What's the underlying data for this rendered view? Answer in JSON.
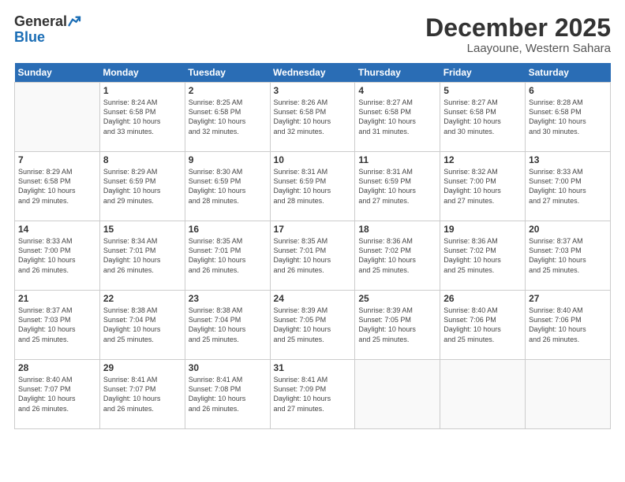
{
  "logo": {
    "line1": "General",
    "line2": "Blue"
  },
  "title": "December 2025",
  "subtitle": "Laayoune, Western Sahara",
  "weekdays": [
    "Sunday",
    "Monday",
    "Tuesday",
    "Wednesday",
    "Thursday",
    "Friday",
    "Saturday"
  ],
  "weeks": [
    [
      {
        "day": "",
        "info": ""
      },
      {
        "day": "1",
        "info": "Sunrise: 8:24 AM\nSunset: 6:58 PM\nDaylight: 10 hours\nand 33 minutes."
      },
      {
        "day": "2",
        "info": "Sunrise: 8:25 AM\nSunset: 6:58 PM\nDaylight: 10 hours\nand 32 minutes."
      },
      {
        "day": "3",
        "info": "Sunrise: 8:26 AM\nSunset: 6:58 PM\nDaylight: 10 hours\nand 32 minutes."
      },
      {
        "day": "4",
        "info": "Sunrise: 8:27 AM\nSunset: 6:58 PM\nDaylight: 10 hours\nand 31 minutes."
      },
      {
        "day": "5",
        "info": "Sunrise: 8:27 AM\nSunset: 6:58 PM\nDaylight: 10 hours\nand 30 minutes."
      },
      {
        "day": "6",
        "info": "Sunrise: 8:28 AM\nSunset: 6:58 PM\nDaylight: 10 hours\nand 30 minutes."
      }
    ],
    [
      {
        "day": "7",
        "info": "Sunrise: 8:29 AM\nSunset: 6:58 PM\nDaylight: 10 hours\nand 29 minutes."
      },
      {
        "day": "8",
        "info": "Sunrise: 8:29 AM\nSunset: 6:59 PM\nDaylight: 10 hours\nand 29 minutes."
      },
      {
        "day": "9",
        "info": "Sunrise: 8:30 AM\nSunset: 6:59 PM\nDaylight: 10 hours\nand 28 minutes."
      },
      {
        "day": "10",
        "info": "Sunrise: 8:31 AM\nSunset: 6:59 PM\nDaylight: 10 hours\nand 28 minutes."
      },
      {
        "day": "11",
        "info": "Sunrise: 8:31 AM\nSunset: 6:59 PM\nDaylight: 10 hours\nand 27 minutes."
      },
      {
        "day": "12",
        "info": "Sunrise: 8:32 AM\nSunset: 7:00 PM\nDaylight: 10 hours\nand 27 minutes."
      },
      {
        "day": "13",
        "info": "Sunrise: 8:33 AM\nSunset: 7:00 PM\nDaylight: 10 hours\nand 27 minutes."
      }
    ],
    [
      {
        "day": "14",
        "info": "Sunrise: 8:33 AM\nSunset: 7:00 PM\nDaylight: 10 hours\nand 26 minutes."
      },
      {
        "day": "15",
        "info": "Sunrise: 8:34 AM\nSunset: 7:01 PM\nDaylight: 10 hours\nand 26 minutes."
      },
      {
        "day": "16",
        "info": "Sunrise: 8:35 AM\nSunset: 7:01 PM\nDaylight: 10 hours\nand 26 minutes."
      },
      {
        "day": "17",
        "info": "Sunrise: 8:35 AM\nSunset: 7:01 PM\nDaylight: 10 hours\nand 26 minutes."
      },
      {
        "day": "18",
        "info": "Sunrise: 8:36 AM\nSunset: 7:02 PM\nDaylight: 10 hours\nand 25 minutes."
      },
      {
        "day": "19",
        "info": "Sunrise: 8:36 AM\nSunset: 7:02 PM\nDaylight: 10 hours\nand 25 minutes."
      },
      {
        "day": "20",
        "info": "Sunrise: 8:37 AM\nSunset: 7:03 PM\nDaylight: 10 hours\nand 25 minutes."
      }
    ],
    [
      {
        "day": "21",
        "info": "Sunrise: 8:37 AM\nSunset: 7:03 PM\nDaylight: 10 hours\nand 25 minutes."
      },
      {
        "day": "22",
        "info": "Sunrise: 8:38 AM\nSunset: 7:04 PM\nDaylight: 10 hours\nand 25 minutes."
      },
      {
        "day": "23",
        "info": "Sunrise: 8:38 AM\nSunset: 7:04 PM\nDaylight: 10 hours\nand 25 minutes."
      },
      {
        "day": "24",
        "info": "Sunrise: 8:39 AM\nSunset: 7:05 PM\nDaylight: 10 hours\nand 25 minutes."
      },
      {
        "day": "25",
        "info": "Sunrise: 8:39 AM\nSunset: 7:05 PM\nDaylight: 10 hours\nand 25 minutes."
      },
      {
        "day": "26",
        "info": "Sunrise: 8:40 AM\nSunset: 7:06 PM\nDaylight: 10 hours\nand 25 minutes."
      },
      {
        "day": "27",
        "info": "Sunrise: 8:40 AM\nSunset: 7:06 PM\nDaylight: 10 hours\nand 26 minutes."
      }
    ],
    [
      {
        "day": "28",
        "info": "Sunrise: 8:40 AM\nSunset: 7:07 PM\nDaylight: 10 hours\nand 26 minutes."
      },
      {
        "day": "29",
        "info": "Sunrise: 8:41 AM\nSunset: 7:07 PM\nDaylight: 10 hours\nand 26 minutes."
      },
      {
        "day": "30",
        "info": "Sunrise: 8:41 AM\nSunset: 7:08 PM\nDaylight: 10 hours\nand 26 minutes."
      },
      {
        "day": "31",
        "info": "Sunrise: 8:41 AM\nSunset: 7:09 PM\nDaylight: 10 hours\nand 27 minutes."
      },
      {
        "day": "",
        "info": ""
      },
      {
        "day": "",
        "info": ""
      },
      {
        "day": "",
        "info": ""
      }
    ]
  ]
}
